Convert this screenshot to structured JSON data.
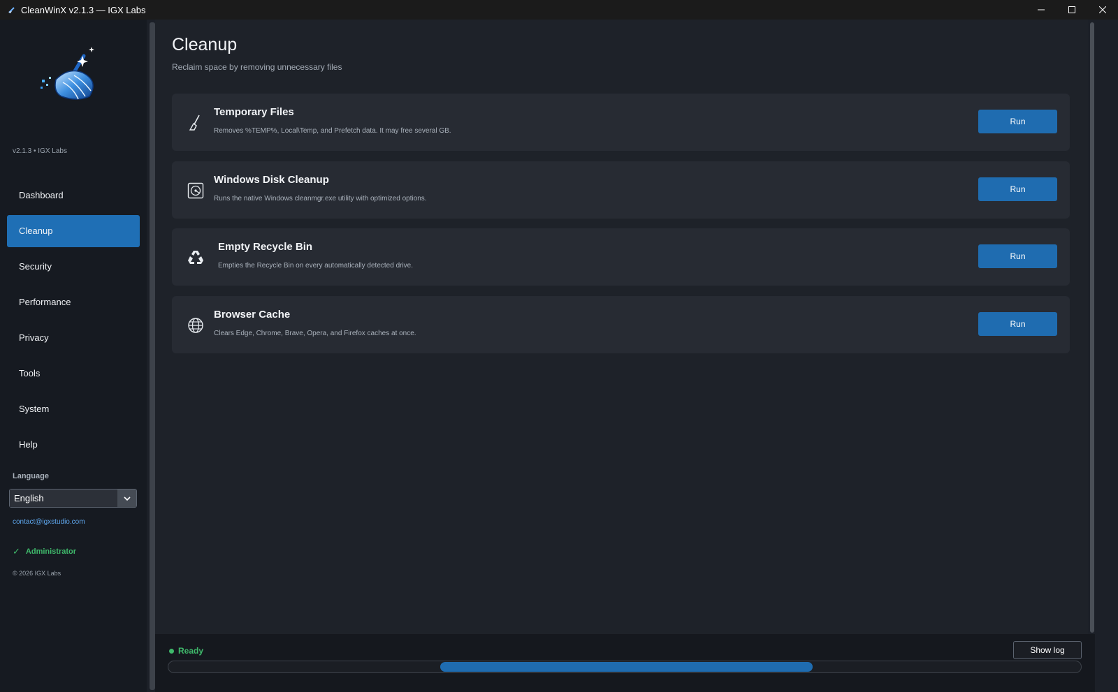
{
  "window": {
    "title": "CleanWinX v2.1.3 — IGX Labs",
    "controls": {
      "minimize": "—",
      "maximize": "☐",
      "close": "✕"
    }
  },
  "sidebar": {
    "version": "v2.1.3 • IGX Labs",
    "nav": [
      {
        "label": "Dashboard",
        "active": false
      },
      {
        "label": "Cleanup",
        "active": true
      },
      {
        "label": "Security",
        "active": false
      },
      {
        "label": "Performance",
        "active": false
      },
      {
        "label": "Privacy",
        "active": false
      },
      {
        "label": "Tools",
        "active": false
      },
      {
        "label": "System",
        "active": false
      },
      {
        "label": "Help",
        "active": false
      }
    ],
    "language_label": "Language",
    "language_value": "English",
    "contact": "contact@igxstudio.com",
    "admin_check": "✓",
    "admin": "Administrator",
    "copyright": "© 2026 IGX Labs"
  },
  "page": {
    "title": "Cleanup",
    "subtitle": "Reclaim space by removing unnecessary files"
  },
  "tasks": [
    {
      "icon": "broom-icon",
      "title": "Temporary Files",
      "description": "Removes %TEMP%, Local\\Temp, and Prefetch data. It may free several GB.",
      "button": "Run"
    },
    {
      "icon": "disk-icon",
      "title": "Windows Disk Cleanup",
      "description": "Runs the native Windows cleanmgr.exe utility with optimized options.",
      "button": "Run"
    },
    {
      "icon": "recycle-icon",
      "title": "Empty Recycle Bin",
      "description": "Empties the Recycle Bin on every automatically detected drive.",
      "button": "Run"
    },
    {
      "icon": "globe-icon",
      "title": "Browser Cache",
      "description": "Clears Edge, Chrome, Brave, Opera, and Firefox caches at once.",
      "button": "Run"
    }
  ],
  "status": {
    "text": "Ready",
    "color": "#3fb96b",
    "show_log": "Show log",
    "accent": "#1f6cb0"
  }
}
